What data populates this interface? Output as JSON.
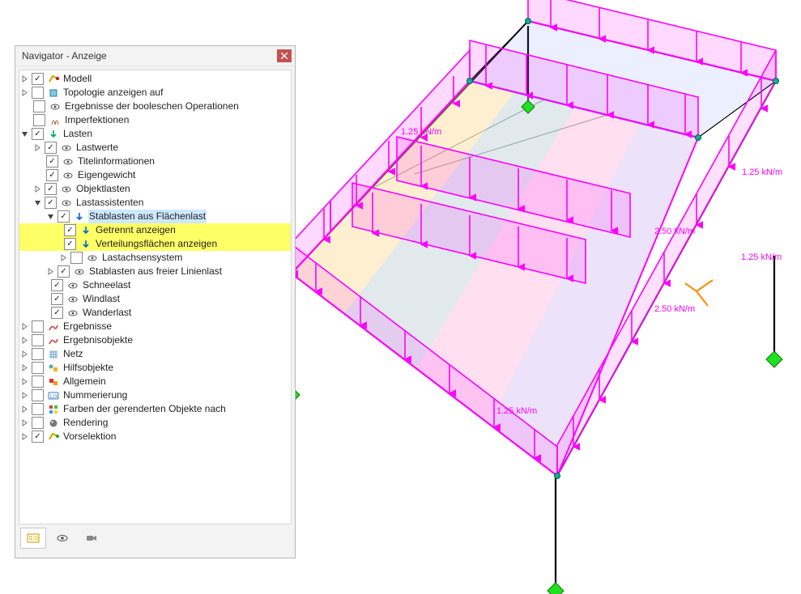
{
  "panel": {
    "title": "Navigator - Anzeige"
  },
  "tree": {
    "modell": "Modell",
    "topologie": "Topologie anzeigen auf",
    "boolesche": "Ergebnisse der booleschen Operationen",
    "imperfektionen": "Imperfektionen",
    "lasten": "Lasten",
    "lastwerte": "Lastwerte",
    "titelinfo": "Titelinformationen",
    "eigengewicht": "Eigengewicht",
    "objektlasten": "Objektlasten",
    "lastassistenten": "Lastassistenten",
    "stablasten_fl": "Stablasten aus Flächenlast",
    "getrennt": "Getrennt anzeigen",
    "verteilung": "Verteilungsflächen anzeigen",
    "lastachsen": "Lastachsensystem",
    "stablasten_linie": "Stablasten aus freier Linienlast",
    "schneelast": "Schneelast",
    "windlast": "Windlast",
    "wanderlast": "Wanderlast",
    "ergebnisse": "Ergebnisse",
    "ergebnisobjekte": "Ergebnisobjekte",
    "netz": "Netz",
    "hilfsobjekte": "Hilfsobjekte",
    "allgemein": "Allgemein",
    "nummerierung": "Nummerierung",
    "farben": "Farben der gerenderten Objekte nach",
    "rendering": "Rendering",
    "vorselektion": "Vorselektion"
  },
  "labels3d": {
    "l1": "1.25 kN/m",
    "l2": "1.25 kN/m",
    "l3": "2.50 kN/m",
    "l4": "1.25 kN/m",
    "l5": "2.50 kN/m",
    "l6": "1.25 kN/m"
  }
}
